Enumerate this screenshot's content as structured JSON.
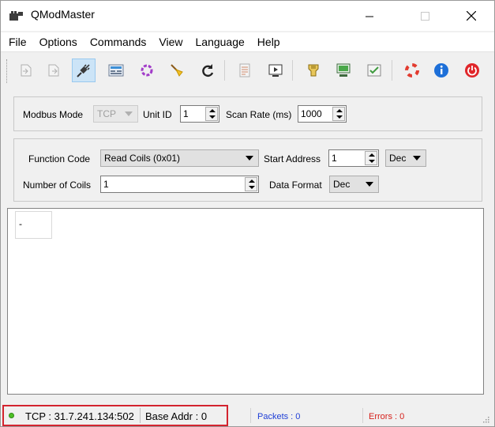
{
  "window": {
    "title": "QModMaster",
    "controls": {
      "minimize": "minimize-icon",
      "maximize": "maximize-icon",
      "close": "close-icon"
    }
  },
  "menu": {
    "items": [
      "File",
      "Options",
      "Commands",
      "View",
      "Language",
      "Help"
    ]
  },
  "toolbar": {
    "icons": [
      "open-icon",
      "save-icon",
      "connect-icon",
      "modbus-rtu-icon",
      "modbus-tcp-icon",
      "clear-icon",
      "refresh-icon",
      "log-icon",
      "bus-monitor-icon",
      "tools-icon",
      "raw-data-icon",
      "read-write-icon",
      "help-icon",
      "about-icon",
      "exit-icon"
    ],
    "active": "connect-icon"
  },
  "mode_group": {
    "modbus_mode_label": "Modbus Mode",
    "modbus_mode_value": "TCP",
    "unit_id_label": "Unit ID",
    "unit_id_value": "1",
    "scan_rate_label": "Scan Rate (ms)",
    "scan_rate_value": "1000"
  },
  "function_group": {
    "function_code_label": "Function Code",
    "function_code_value": "Read Coils (0x01)",
    "start_address_label": "Start Address",
    "start_address_value": "1",
    "start_address_format": "Dec",
    "number_label": "Number of Coils",
    "number_value": "1",
    "data_format_label": "Data Format",
    "data_format_value": "Dec"
  },
  "data_area": {
    "cells": [
      "-"
    ]
  },
  "status": {
    "connection": "TCP : 31.7.241.134:502",
    "base_addr": "Base Addr : 0",
    "packets": "Packets : 0",
    "errors": "Errors : 0",
    "led_color": "#4ec126",
    "highlight_color": "#d3242f"
  }
}
